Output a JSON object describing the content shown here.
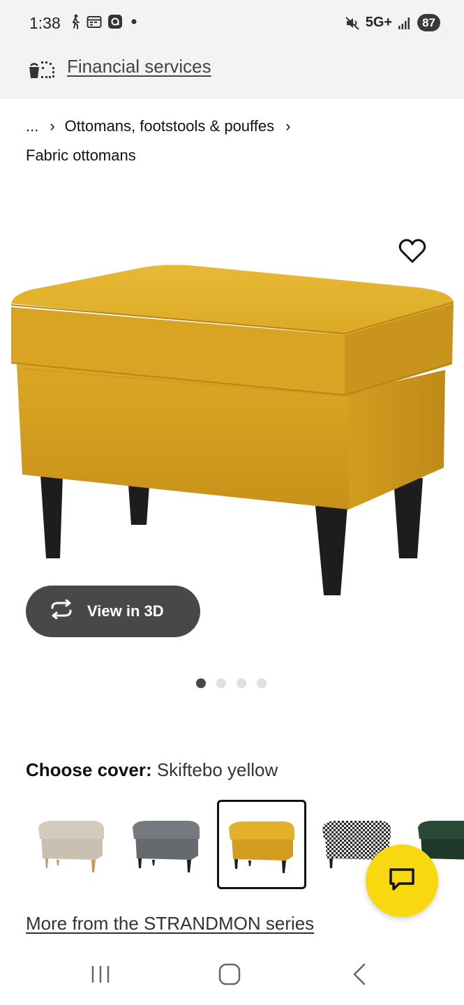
{
  "status_bar": {
    "time": "1:38",
    "network": "5G+",
    "battery": "87",
    "icons": [
      "walk-icon",
      "calendar-icon",
      "app-icon",
      "dot-icon",
      "mute-icon",
      "signal-icon"
    ]
  },
  "financial_bar": {
    "icon": "delivery-icon",
    "link_label": "Financial services"
  },
  "breadcrumb": {
    "ellipsis": "...",
    "separator": "›",
    "parent": "Ottomans, footstools & pouffes",
    "current": "Fabric ottomans"
  },
  "product": {
    "image": "yellow-ottoman-image",
    "favorite_icon": "heart-icon",
    "view_3d_label": "View in 3D",
    "view_3d_icon": "rotate-icon",
    "carousel": {
      "count": 4,
      "active_index": 0
    }
  },
  "cover": {
    "label": "Choose cover:",
    "value": "Skiftebo yellow",
    "swatches": [
      {
        "name": "beige",
        "color": "#c9c0b1",
        "selected": false
      },
      {
        "name": "grey",
        "color": "#6b6e72",
        "selected": false
      },
      {
        "name": "yellow",
        "color": "#d6a81d",
        "selected": true
      },
      {
        "name": "houndstooth",
        "color": "#8a8a8a",
        "selected": false
      },
      {
        "name": "dark-green",
        "color": "#1f3a2a",
        "selected": false
      }
    ]
  },
  "series_link": "More from the STRANDMON series",
  "chat_icon": "chat-icon",
  "colors": {
    "accent_yellow": "#f8d90f",
    "dark_button": "#484848",
    "bar_background": "#f3f3f3"
  },
  "nav": {
    "recent_icon": "recent-apps-icon",
    "home_icon": "home-icon",
    "back_icon": "back-icon"
  }
}
